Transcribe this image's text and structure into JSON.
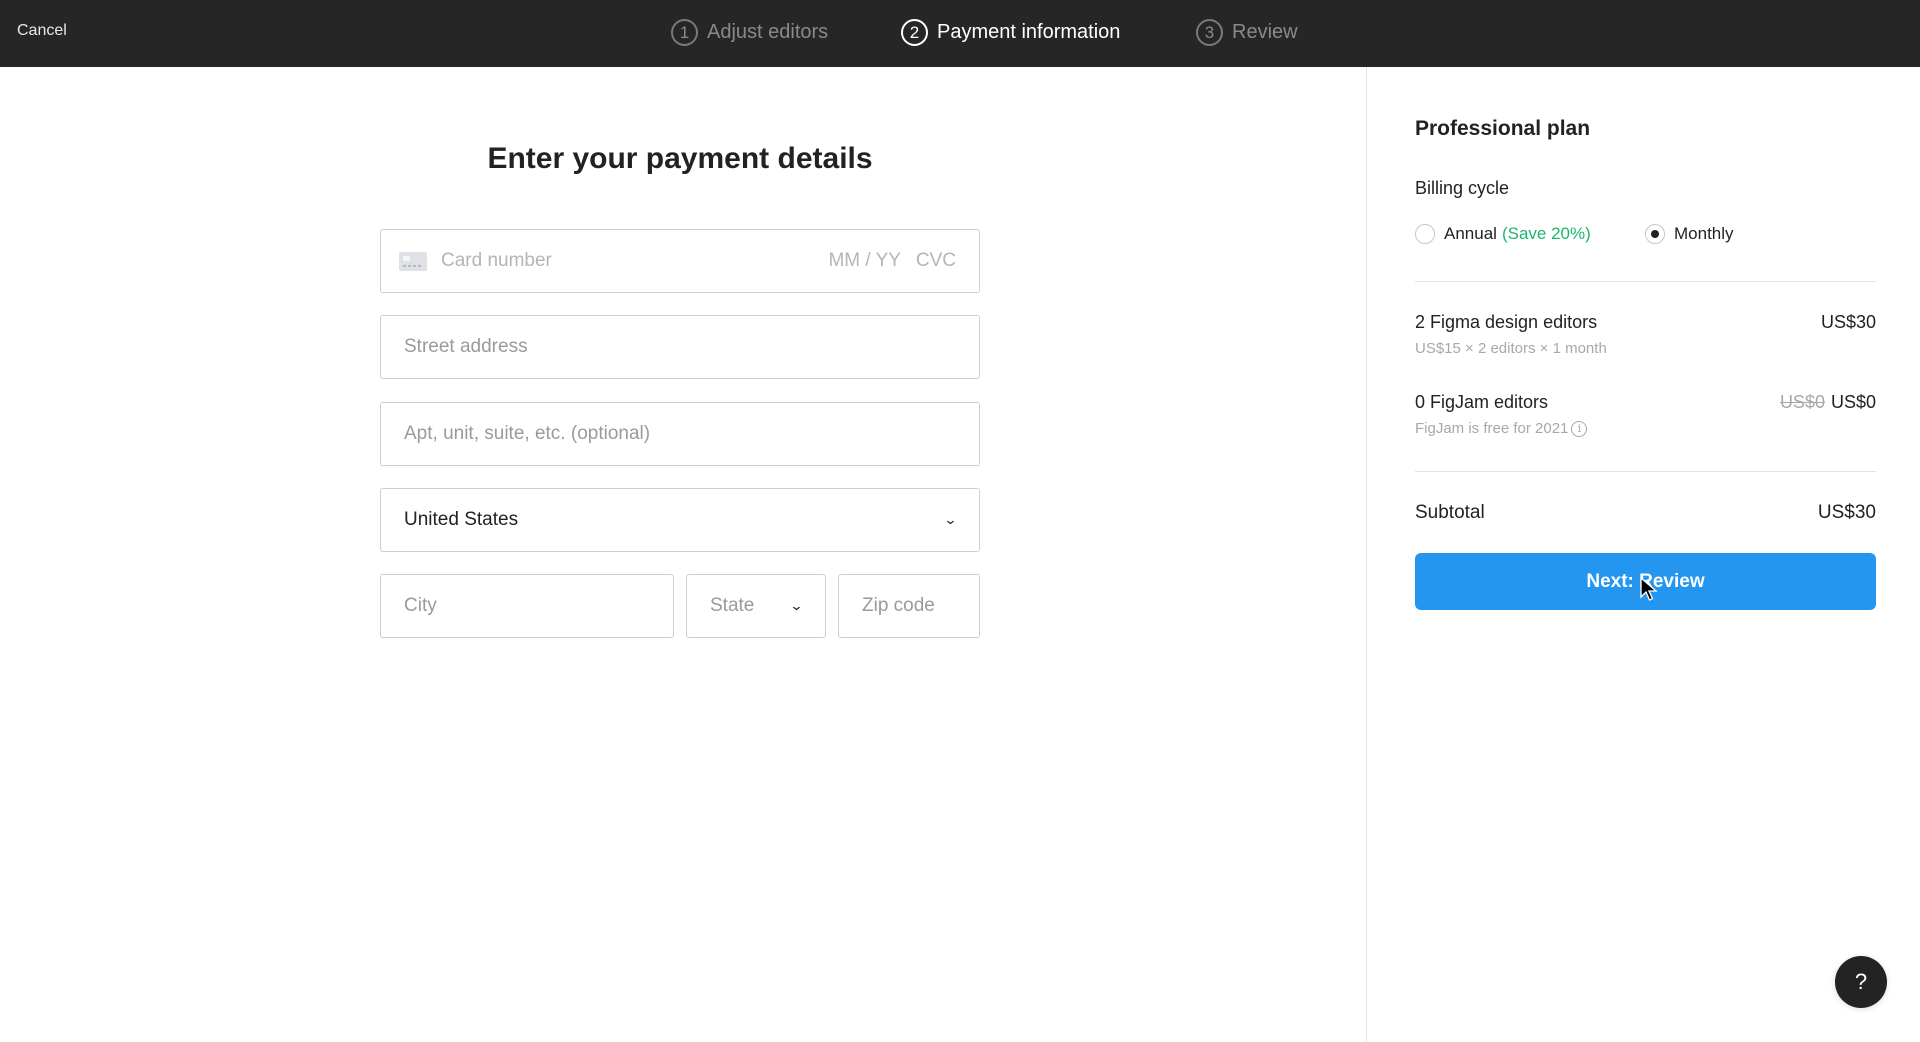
{
  "topbar": {
    "cancel_label": "Cancel",
    "steps": [
      {
        "number": "1",
        "label": "Adjust editors",
        "state": "inactive"
      },
      {
        "number": "2",
        "label": "Payment information",
        "state": "active"
      },
      {
        "number": "3",
        "label": "Review",
        "state": "inactive"
      }
    ]
  },
  "form": {
    "heading": "Enter your payment details",
    "card": {
      "icon": "credit-card-icon",
      "number_placeholder": "Card number",
      "expiry_placeholder": "MM / YY",
      "cvc_placeholder": "CVC"
    },
    "street_placeholder": "Street address",
    "apt_placeholder": "Apt, unit, suite, etc. (optional)",
    "country_value": "United States",
    "city_placeholder": "City",
    "state_placeholder": "State",
    "zip_placeholder": "Zip code",
    "chevron_icon": "chevron-down-icon"
  },
  "sidebar": {
    "plan_title": "Professional plan",
    "billing_cycle_label": "Billing cycle",
    "billing_options": [
      {
        "label": "Annual",
        "note": "(Save 20%)",
        "selected": false
      },
      {
        "label": "Monthly",
        "note": "",
        "selected": true
      }
    ],
    "line_items": [
      {
        "title": "2 Figma design editors",
        "price": "US$30",
        "original_price": "",
        "subtitle": "US$15 × 2 editors × 1 month"
      },
      {
        "title": "0 FigJam editors",
        "price": "US$0",
        "original_price": "US$0",
        "subtitle": "FigJam is free for 2021"
      }
    ],
    "subtotal_label": "Subtotal",
    "subtotal_value": "US$30",
    "next_button_label": "Next: Review"
  },
  "help_button_label": "?",
  "colors": {
    "topbar_bg": "#262626",
    "primary_button": "#2496f0",
    "save_text": "#1bb66a"
  }
}
